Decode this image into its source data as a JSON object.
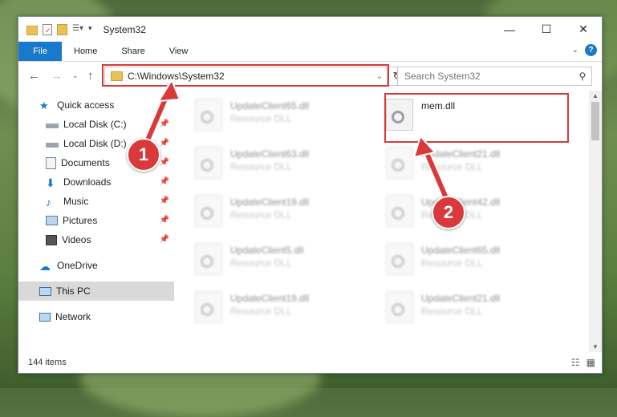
{
  "window": {
    "title": "System32",
    "controls": {
      "minimize": "—",
      "maximize": "☐",
      "close": "✕"
    }
  },
  "ribbon": {
    "tabs": [
      {
        "label": "File"
      },
      {
        "label": "Home"
      },
      {
        "label": "Share"
      },
      {
        "label": "View"
      }
    ],
    "help": "?"
  },
  "address_bar": {
    "path": "C:\\Windows\\System32",
    "search_placeholder": "Search System32"
  },
  "nav_pane": {
    "items": [
      {
        "label": "Quick access",
        "icon": "star-icon",
        "pinned": false
      },
      {
        "label": "Local Disk (C:)",
        "icon": "drive-icon",
        "pinned": true
      },
      {
        "label": "Local Disk (D:)",
        "icon": "drive-icon",
        "pinned": true
      },
      {
        "label": "Documents",
        "icon": "documents-icon",
        "pinned": true
      },
      {
        "label": "Downloads",
        "icon": "download-icon",
        "pinned": true
      },
      {
        "label": "Music",
        "icon": "music-icon",
        "pinned": true
      },
      {
        "label": "Pictures",
        "icon": "pictures-icon",
        "pinned": true
      },
      {
        "label": "Videos",
        "icon": "videos-icon",
        "pinned": true
      },
      {
        "label": "OneDrive",
        "icon": "cloud-icon",
        "pinned": false
      },
      {
        "label": "This PC",
        "icon": "pc-icon",
        "pinned": false,
        "selected": true
      },
      {
        "label": "Network",
        "icon": "network-icon",
        "pinned": false
      }
    ]
  },
  "files": {
    "left_column": [
      {
        "name": "UpdateClient65.dll",
        "type": "Resource DLL"
      },
      {
        "name": "UpdateClient63.dll",
        "type": "Resource DLL"
      },
      {
        "name": "UpdateClient19.dll",
        "type": "Resource DLL"
      },
      {
        "name": "UpdateClient5.dll",
        "type": "Resource DLL"
      },
      {
        "name": "UpdateClient19.dll",
        "type": "Resource DLL"
      }
    ],
    "right_column": [
      {
        "name": "mem.dll",
        "type": ""
      },
      {
        "name": "UpdateClient21.dll",
        "type": "Resource DLL"
      },
      {
        "name": "UpdateClient42.dll",
        "type": "Resource DLL"
      },
      {
        "name": "UpdateClient65.dll",
        "type": "Resource DLL"
      },
      {
        "name": "UpdateClient21.dll",
        "type": "Resource DLL"
      }
    ]
  },
  "status_bar": {
    "item_count": "144 items"
  },
  "callouts": [
    {
      "label": "1"
    },
    {
      "label": "2"
    }
  ],
  "colors": {
    "accent": "#1979ca",
    "highlight": "#d9393b",
    "folder": "#e8c15a"
  }
}
